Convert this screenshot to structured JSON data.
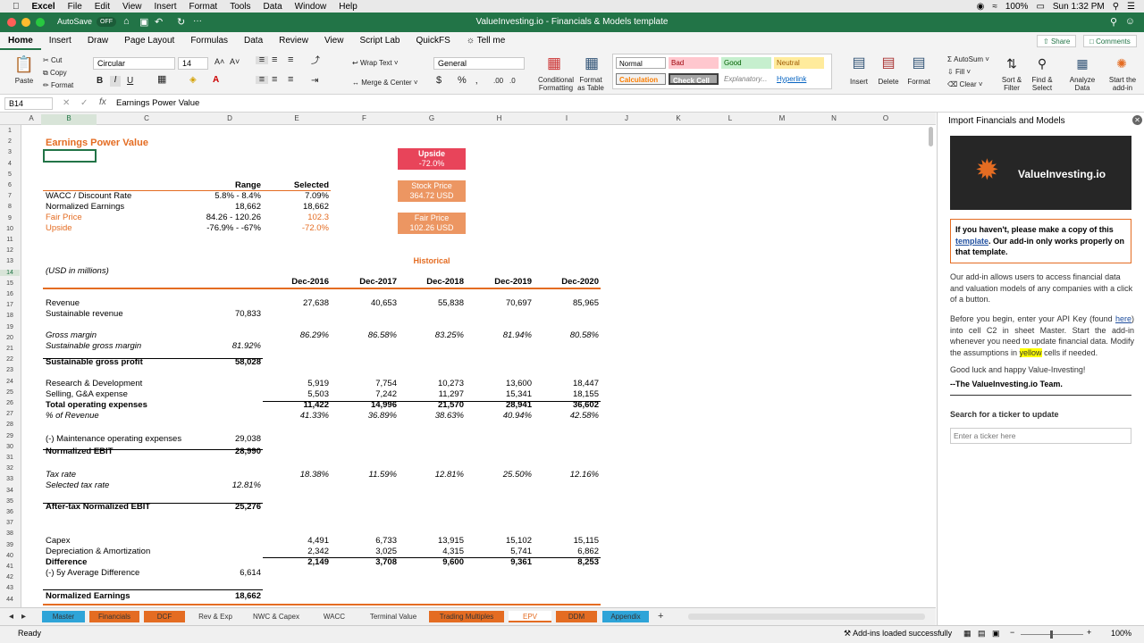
{
  "mac": {
    "app": "Excel",
    "menus": [
      "File",
      "Edit",
      "View",
      "Insert",
      "Format",
      "Tools",
      "Data",
      "Window",
      "Help"
    ],
    "battery": "100%",
    "time": "Sun 1:32 PM"
  },
  "window": {
    "autosave": "AutoSave",
    "autosave_state": "OFF",
    "title": "ValueInvesting.io - Financials & Models template"
  },
  "tabs": [
    "Home",
    "Insert",
    "Draw",
    "Page Layout",
    "Formulas",
    "Data",
    "Review",
    "View",
    "Script Lab",
    "QuickFS"
  ],
  "tell_me": "Tell me",
  "share": "Share",
  "comments": "Comments",
  "ribbon": {
    "paste": "Paste",
    "cut": "Cut",
    "copy": "Copy",
    "format": "Format",
    "font": "Circular",
    "font_size": "14",
    "wrap": "Wrap Text",
    "merge": "Merge & Center",
    "numfmt": "General",
    "cond": "Conditional Formatting",
    "fmt_table": "Format as Table",
    "insert": "Insert",
    "delete": "Delete",
    "format2": "Format",
    "autosum": "AutoSum",
    "fill": "Fill",
    "clear": "Clear",
    "sort": "Sort & Filter",
    "find": "Find & Select",
    "analyze": "Analyze Data",
    "start": "Start the add-in",
    "styles": {
      "normal": "Normal",
      "bad": "Bad",
      "good": "Good",
      "neutral": "Neutral",
      "calculation": "Calculation",
      "check": "Check Cell",
      "explanatory": "Explanatory...",
      "hyperlink": "Hyperlink"
    }
  },
  "formula": {
    "cell": "B14",
    "fx": "fx",
    "value": "Earnings Power Value"
  },
  "columns": [
    "A",
    "B",
    "C",
    "D",
    "E",
    "F",
    "G",
    "H",
    "I",
    "J",
    "K",
    "L",
    "M",
    "N",
    "O"
  ],
  "rows": [
    "1",
    "2",
    "3",
    "4",
    "5",
    "6",
    "7",
    "8",
    "9",
    "10",
    "11",
    "12",
    "13",
    "14",
    "15",
    "16",
    "17",
    "18",
    "19",
    "20",
    "21",
    "22",
    "23",
    "24",
    "25",
    "26",
    "27",
    "28",
    "29",
    "30",
    "31",
    "32",
    "33",
    "34",
    "35",
    "36",
    "37",
    "38",
    "39",
    "40",
    "41",
    "42",
    "43",
    "44"
  ],
  "sheet": {
    "title": "Earnings Power Value",
    "upside_box": {
      "label": "Upside",
      "value": "-72.0%"
    },
    "price_box": {
      "label": "Stock Price",
      "value": "364.72 USD"
    },
    "fair_box": {
      "label": "Fair Price",
      "value": "102.26 USD"
    },
    "range_hdr": "Range",
    "selected_hdr": "Selected",
    "summary": [
      {
        "label": "WACC / Discount Rate",
        "range": "5.8% - 8.4%",
        "sel": "7.09%"
      },
      {
        "label": "Normalized Earnings",
        "range": "18,662",
        "sel": "18,662"
      },
      {
        "label": "Fair Price",
        "range": "84.26 - 120.26",
        "sel": "102.3"
      },
      {
        "label": "Upside",
        "range": "-76.9% - -67%",
        "sel": "-72.0%"
      }
    ],
    "historical": "Historical",
    "units": "(USD in millions)",
    "years": [
      "Dec-2016",
      "Dec-2017",
      "Dec-2018",
      "Dec-2019",
      "Dec-2020"
    ],
    "lines": [
      {
        "label": "Revenue",
        "sel": "",
        "v": [
          "27,638",
          "40,653",
          "55,838",
          "70,697",
          "85,965"
        ]
      },
      {
        "label": "Sustainable revenue",
        "sel": "70,833",
        "v": [
          "",
          "",
          "",
          "",
          ""
        ]
      },
      {
        "label": "Gross margin",
        "sel": "",
        "v": [
          "86.29%",
          "86.58%",
          "83.25%",
          "81.94%",
          "80.58%"
        ]
      },
      {
        "label": "Sustainable gross margin",
        "sel": "81.92%",
        "v": [
          "",
          "",
          "",
          "",
          ""
        ]
      },
      {
        "label": "Sustainable gross profit",
        "sel": "58,028",
        "v": [
          "",
          "",
          "",
          "",
          ""
        ]
      },
      {
        "label": "Research & Development",
        "sel": "",
        "v": [
          "5,919",
          "7,754",
          "10,273",
          "13,600",
          "18,447"
        ]
      },
      {
        "label": "Selling, G&A expense",
        "sel": "",
        "v": [
          "5,503",
          "7,242",
          "11,297",
          "15,341",
          "18,155"
        ]
      },
      {
        "label": "Total operating expenses",
        "sel": "",
        "v": [
          "11,422",
          "14,996",
          "21,570",
          "28,941",
          "36,602"
        ]
      },
      {
        "label": "% of Revenue",
        "sel": "",
        "v": [
          "41.33%",
          "36.89%",
          "38.63%",
          "40.94%",
          "42.58%"
        ]
      },
      {
        "label": "(-) Maintenance operating expenses",
        "sel": "29,038",
        "v": [
          "",
          "",
          "",
          "",
          ""
        ]
      },
      {
        "label": "Normalized EBIT",
        "sel": "28,990",
        "v": [
          "",
          "",
          "",
          "",
          ""
        ]
      },
      {
        "label": "Tax rate",
        "sel": "",
        "v": [
          "18.38%",
          "11.59%",
          "12.81%",
          "25.50%",
          "12.16%"
        ]
      },
      {
        "label": "Selected tax rate",
        "sel": "12.81%",
        "v": [
          "",
          "",
          "",
          "",
          ""
        ]
      },
      {
        "label": "After-tax Normalized EBIT",
        "sel": "25,276",
        "v": [
          "",
          "",
          "",
          "",
          ""
        ]
      },
      {
        "label": "Capex",
        "sel": "",
        "v": [
          "4,491",
          "6,733",
          "13,915",
          "15,102",
          "15,115"
        ]
      },
      {
        "label": "Depreciation & Amortization",
        "sel": "",
        "v": [
          "2,342",
          "3,025",
          "4,315",
          "5,741",
          "6,862"
        ]
      },
      {
        "label": "Difference",
        "sel": "",
        "v": [
          "2,149",
          "3,708",
          "9,600",
          "9,361",
          "8,253"
        ]
      },
      {
        "label": "(-) 5y Average Difference",
        "sel": "6,614",
        "v": [
          "",
          "",
          "",
          "",
          ""
        ]
      },
      {
        "label": "Normalized Earnings",
        "sel": "18,662",
        "v": [
          "",
          "",
          "",
          "",
          ""
        ]
      }
    ]
  },
  "sheet_tabs": [
    "Master",
    "Financials",
    "DCF",
    "Rev & Exp",
    "NWC & Capex",
    "WACC",
    "Terminal Value",
    "Trading Multiples",
    "EPV",
    "DDM",
    "Appendix"
  ],
  "status": {
    "ready": "Ready",
    "addins": "Add-ins loaded successfully",
    "zoom": "100%"
  },
  "pane": {
    "title": "Import Financials and Models",
    "logo": "ValueInvesting.io",
    "note_a": "If you haven't, please make a copy of this ",
    "note_link": "template",
    "note_b": ". Our add-in only works properly on that template.",
    "p1": "Our add-in allows users to access financial data and valuation models of any companies with a click of a button.",
    "p2a": "Before you begin, enter your API Key (found ",
    "p2link": "here",
    "p2b": ") into cell C2 in sheet Master. Start the add-in whenever you need to update financial data. Modify the assumptions in ",
    "p2y": "yellow",
    "p2c": " cells if needed.",
    "p3": "Good luck and happy Value-Investing!",
    "sign": "--The ValueInvesting.io Team.",
    "search_label": "Search for a ticker to update",
    "search_ph": "Enter a ticker here"
  }
}
